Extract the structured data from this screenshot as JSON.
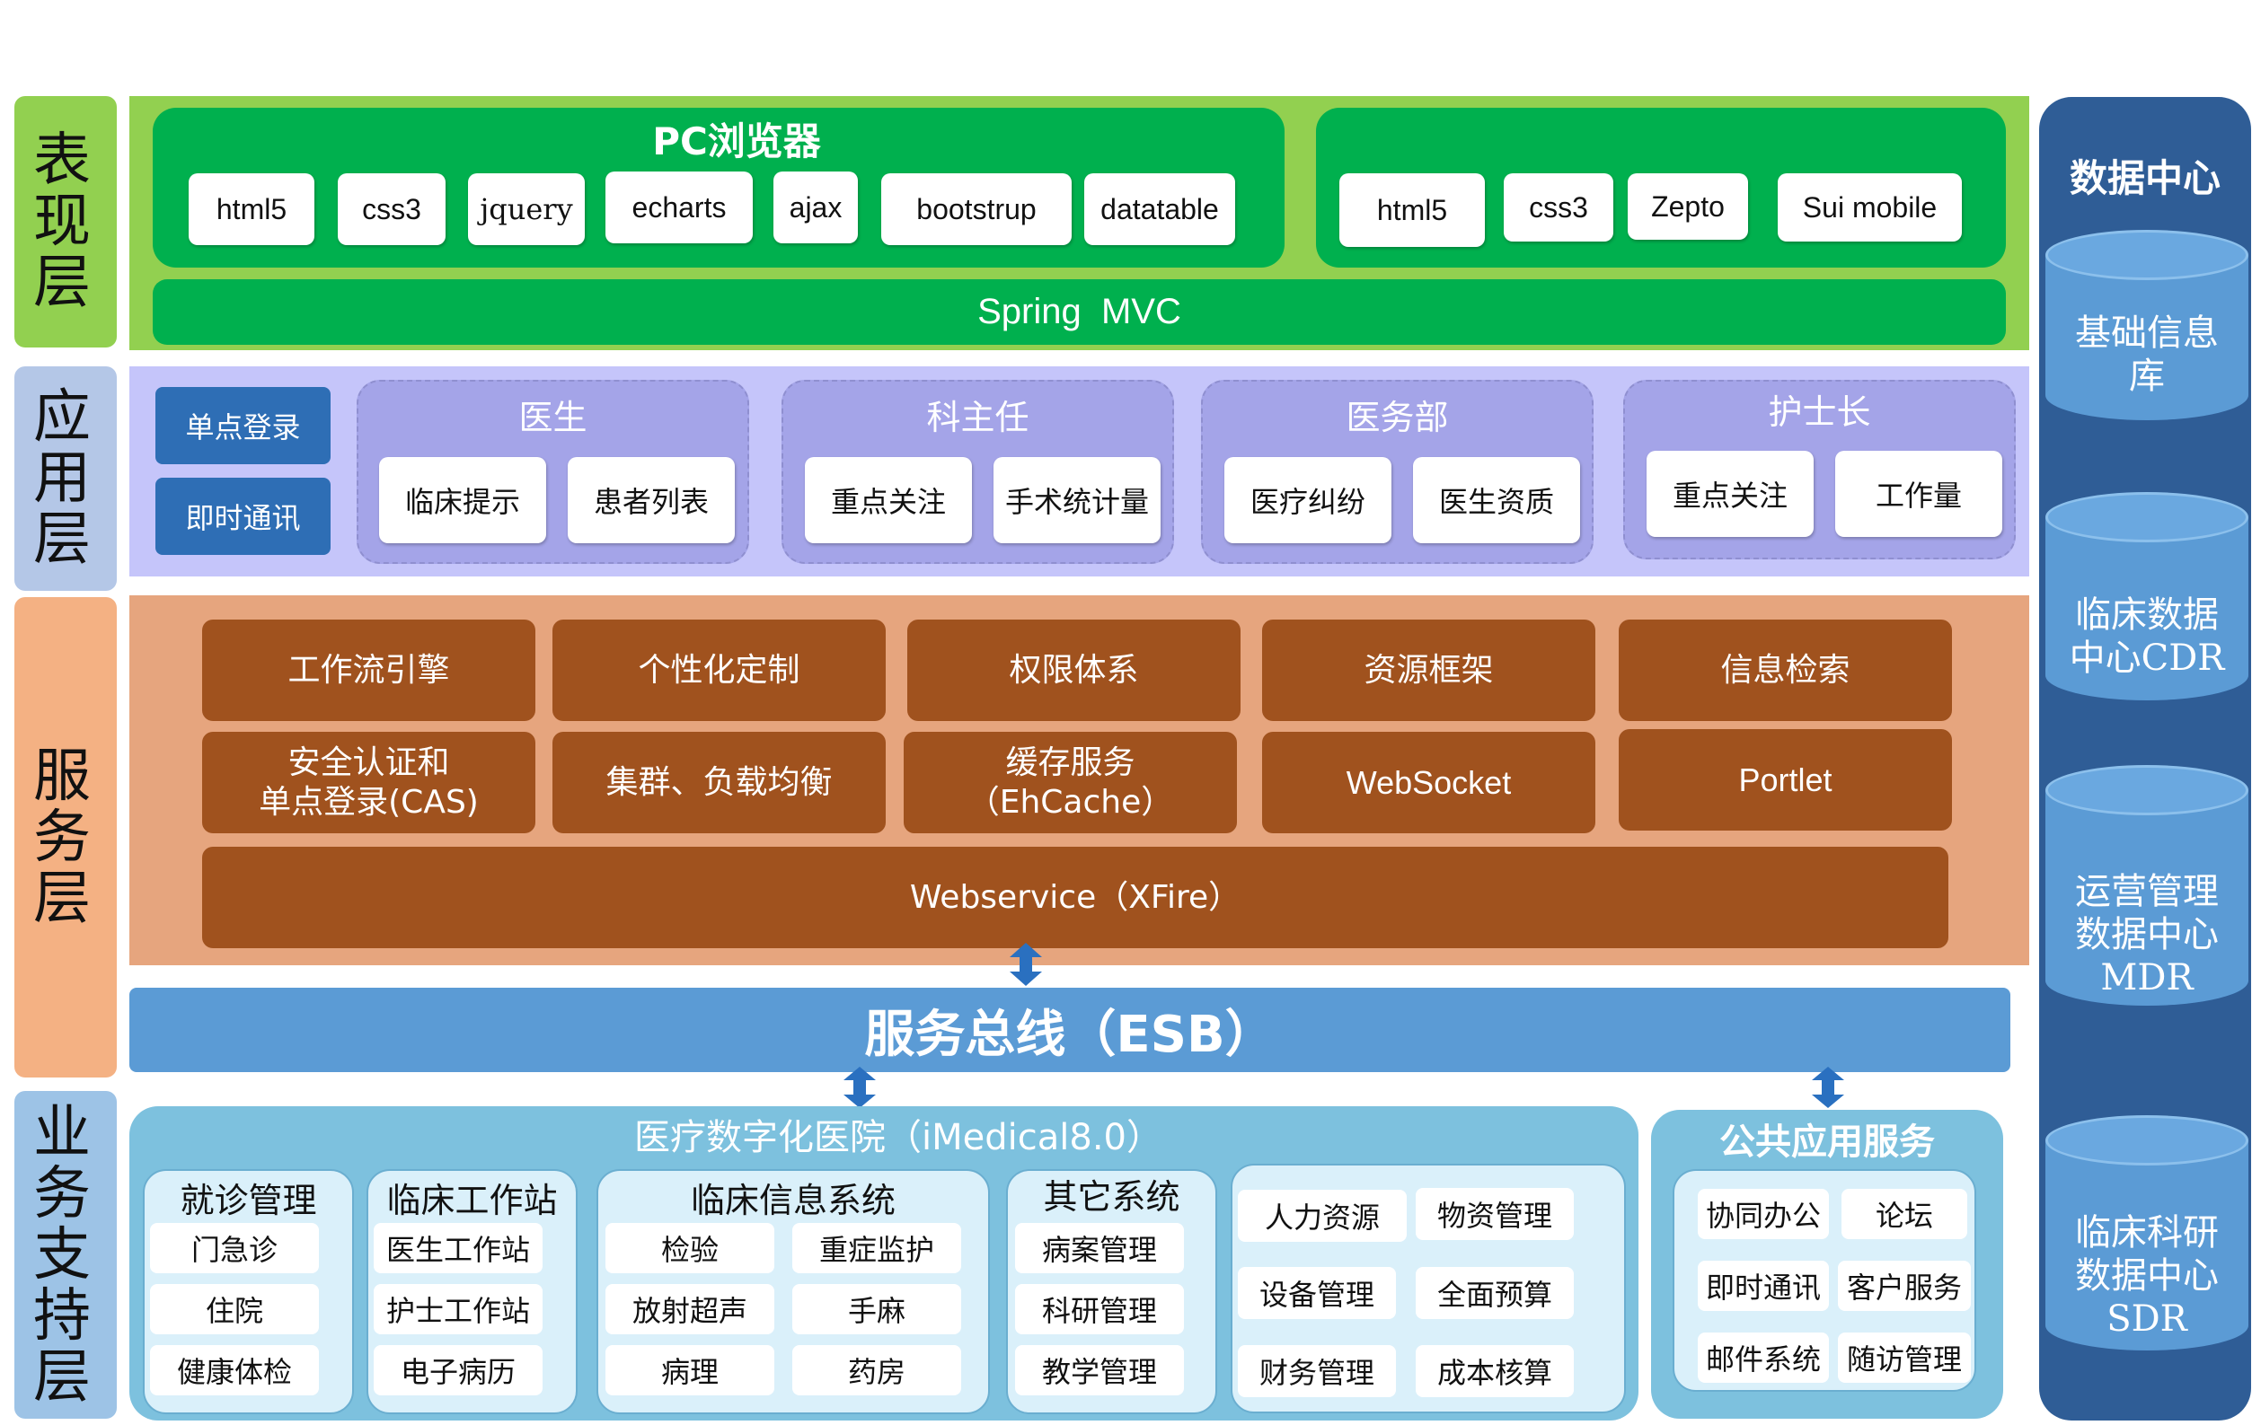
{
  "layers": {
    "presentation": "表现层",
    "application": "应用层",
    "service": "服务层",
    "business": "业务支持层"
  },
  "presentation": {
    "pc_title": "PC浏览器",
    "pc_tech": [
      "html5",
      "css3",
      "jquery",
      "echarts",
      "ajax",
      "bootstrup",
      "datatable"
    ],
    "mobile_tech": [
      "html5",
      "css3",
      "Zepto",
      "Sui mobile"
    ],
    "framework": "Spring  MVC"
  },
  "application": {
    "login": "单点登录",
    "im": "即时通讯",
    "roles": [
      {
        "title": "医生",
        "items": [
          "临床提示",
          "患者列表"
        ]
      },
      {
        "title": "科主任",
        "items": [
          "重点关注",
          "手术统计量"
        ]
      },
      {
        "title": "医务部",
        "items": [
          "医疗纠纷",
          "医生资质"
        ]
      },
      {
        "title": "护士长",
        "items": [
          "重点关注",
          "工作量"
        ]
      }
    ]
  },
  "service": {
    "row1": [
      "工作流引擎",
      "个性化定制",
      "权限体系",
      "资源框架",
      "信息检索"
    ],
    "row2_1": "安全认证和",
    "row2_1b": "单点登录(CAS)",
    "row2_2": "集群、负载均衡",
    "row2_3": "缓存服务",
    "row2_3b": "（EhCache）",
    "row2_4": "WebSocket",
    "row2_5": "Portlet",
    "webservice": "Webservice（XFire）"
  },
  "esb": "服务总线（ESB）",
  "business": {
    "hospital_title": "医疗数字化医院（iMedical8.0）",
    "groups": [
      {
        "title": "就诊管理",
        "items": [
          "门急诊",
          "住院",
          "健康体检"
        ]
      },
      {
        "title": "临床工作站",
        "items": [
          "医生工作站",
          "护士工作站",
          "电子病历"
        ]
      },
      {
        "title": "临床信息系统",
        "items": [
          "检验",
          "重症监护",
          "放射超声",
          "手麻",
          "病理",
          "药房"
        ]
      },
      {
        "title": "其它系统",
        "items": [
          "病案管理",
          "科研管理",
          "教学管理"
        ]
      }
    ],
    "other_items": [
      "人力资源",
      "物资管理",
      "设备管理",
      "全面预算",
      "财务管理",
      "成本核算"
    ],
    "public_title": "公共应用服务",
    "public_items": [
      "协同办公",
      "论坛",
      "即时通讯",
      "客户服务",
      "邮件系统",
      "随访管理"
    ]
  },
  "data_center": {
    "title": "数据中心",
    "dbs": [
      [
        "基础信息",
        "库"
      ],
      [
        "临床数据",
        "中心CDR"
      ],
      [
        "运营管理",
        "数据中心",
        "MDR"
      ],
      [
        "临床科研",
        "数据中心",
        "SDR"
      ]
    ]
  },
  "colors": {
    "presentation_label": "#92d050",
    "application_label": "#b4c7e7",
    "service_label": "#f4b183",
    "business_label": "#9dc3e6",
    "green": "#00b04e",
    "lavender": "#c5c5fa",
    "service_bg": "#e6a57e",
    "service_box": "#a0521e",
    "esb": "#5b9bd5",
    "data_center": "#2f5d96"
  }
}
